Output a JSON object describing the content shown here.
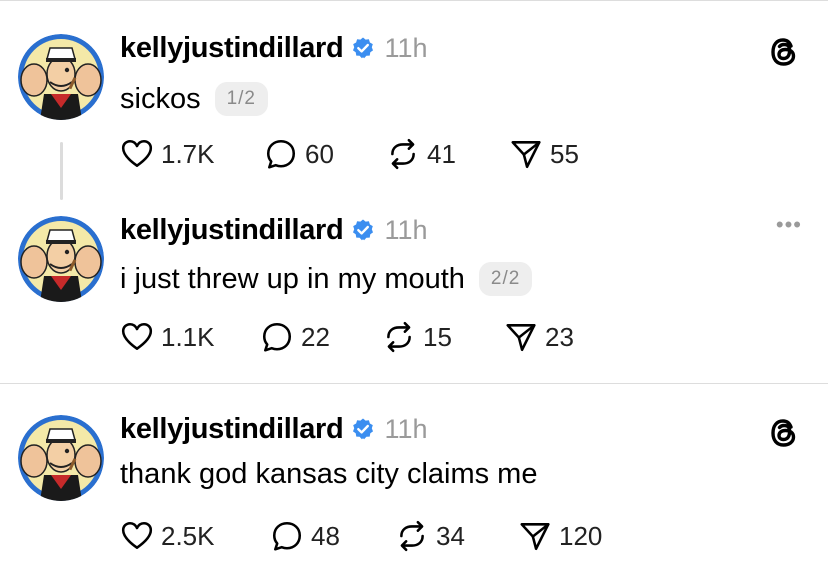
{
  "posts": [
    {
      "username": "kellyjustindillard",
      "time": "11h",
      "text": "sickos",
      "pill": "1/2",
      "corner_icon": "threads-logo-icon",
      "likes": "1.7K",
      "replies": "60",
      "reposts": "41",
      "shares": "55"
    },
    {
      "username": "kellyjustindillard",
      "time": "11h",
      "text": "i just threw up in my mouth",
      "pill": "2/2",
      "corner_icon": "more-options-icon",
      "more": "•••",
      "likes": "1.1K",
      "replies": "22",
      "reposts": "15",
      "shares": "23"
    },
    {
      "username": "kellyjustindillard",
      "time": "11h",
      "text": "thank god kansas city claims me",
      "corner_icon": "threads-logo-icon",
      "likes": "2.5K",
      "replies": "48",
      "reposts": "34",
      "shares": "120"
    }
  ],
  "colors": {
    "verified": "#3b8ef0",
    "muted": "#9a9a9a",
    "divider": "#dddddd"
  }
}
